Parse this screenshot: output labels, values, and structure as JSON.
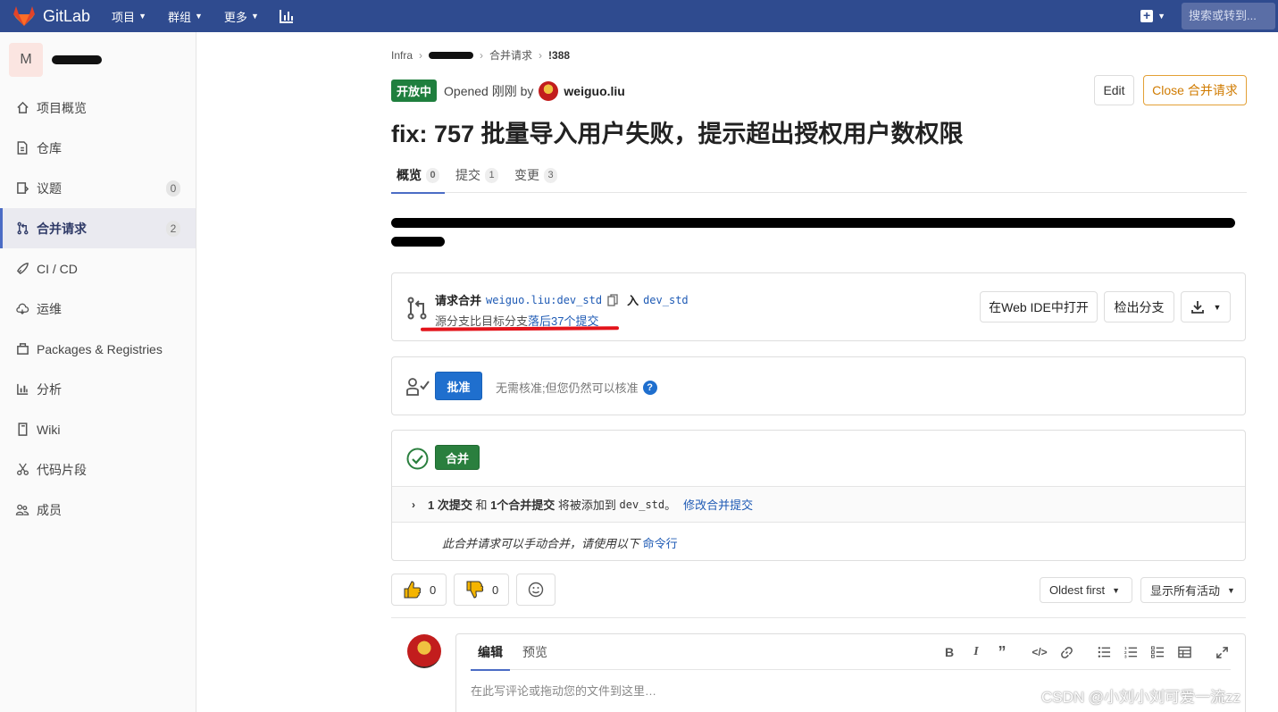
{
  "topnav": {
    "brand": "GitLab",
    "menu": [
      "项目",
      "群组",
      "更多"
    ],
    "search_placeholder": "搜索或转到..."
  },
  "sidebar": {
    "project_initial": "M",
    "items": [
      {
        "label": "项目概览",
        "icon": "home-icon"
      },
      {
        "label": "仓库",
        "icon": "doc-icon"
      },
      {
        "label": "议题",
        "icon": "issues-icon",
        "count": "0"
      },
      {
        "label": "合并请求",
        "icon": "merge-request-icon",
        "count": "2",
        "active": true
      },
      {
        "label": "CI / CD",
        "icon": "rocket-icon"
      },
      {
        "label": "运维",
        "icon": "cloud-icon"
      },
      {
        "label": "Packages & Registries",
        "icon": "package-icon"
      },
      {
        "label": "分析",
        "icon": "chart-icon"
      },
      {
        "label": "Wiki",
        "icon": "book-icon"
      },
      {
        "label": "代码片段",
        "icon": "scissors-icon"
      },
      {
        "label": "成员",
        "icon": "users-icon"
      }
    ]
  },
  "breadcrumb": {
    "root": "Infra",
    "section": "合并请求",
    "id": "!388"
  },
  "mr": {
    "status": "开放中",
    "opened": "Opened 刚刚 by",
    "author": "weiguo.liu",
    "title": "fix: 757 批量导入用户失败，提示超出授权用户数权限",
    "edit_label": "Edit",
    "close_label": "Close 合并请求"
  },
  "tabs": [
    {
      "label": "概览",
      "count": "0"
    },
    {
      "label": "提交",
      "count": "1"
    },
    {
      "label": "变更",
      "count": "3"
    }
  ],
  "request": {
    "prefix": "请求合并",
    "source": "weiguo.liu:dev_std",
    "into": "入",
    "target": "dev_std",
    "behind_text": "源分支比目标分支",
    "behind_link": "落后37个提交",
    "ide_button": "在Web IDE中打开",
    "checkout_button": "检出分支"
  },
  "approval": {
    "button": "批准",
    "text": "无需核准;但您仍然可以核准",
    "help": "?"
  },
  "merge": {
    "button": "合并",
    "commits_bold1": "1 次提交",
    "commits_and": " 和 ",
    "commits_bold2": "1个合并提交",
    "commits_rest": " 将被添加到 ",
    "commits_branch": "dev_std",
    "commits_end": "。",
    "edit_link": "修改合并提交",
    "manual_text": "此合并请求可以手动合并，请使用以下",
    "manual_link": "命令行"
  },
  "reactions": {
    "thumbs_up": "0",
    "thumbs_down": "0"
  },
  "sort": {
    "order": "Oldest first",
    "filter": "显示所有活动"
  },
  "editor": {
    "tab_write": "编辑",
    "tab_preview": "预览",
    "placeholder": "在此写评论或拖动您的文件到这里…"
  },
  "watermark": "CSDN @小刘小刘可爱一流zz",
  "colors": {
    "nav": "#2f4b8f",
    "open_badge": "#1f7f3e",
    "approve": "#1f6fce",
    "merge": "#2a7f3e",
    "close": "#d07b00",
    "annotation": "#e3141b"
  }
}
